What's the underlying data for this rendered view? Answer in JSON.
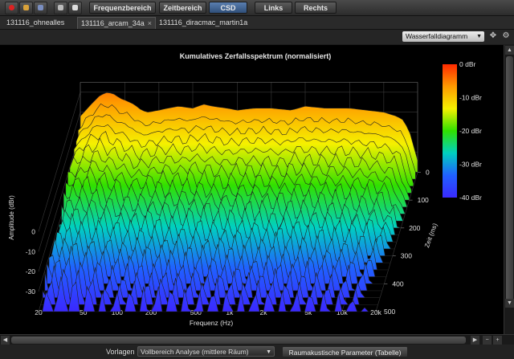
{
  "toolbar": {
    "icons": [
      "record-icon",
      "open-folder-icon",
      "save-icon",
      "export-icon",
      "print-icon"
    ],
    "tabs": [
      {
        "label": "Frequenzbereich",
        "active": false
      },
      {
        "label": "Zeitbereich",
        "active": false
      },
      {
        "label": "CSD",
        "active": true
      },
      {
        "label": "Links",
        "active": false
      },
      {
        "label": "Rechts",
        "active": false
      }
    ]
  },
  "file_tabs": [
    {
      "label": "131116_ohnealles",
      "active": false
    },
    {
      "label": "131116_arcam_34a",
      "active": true,
      "close": "×"
    },
    {
      "label": "131116_diracmac_martin1a",
      "active": false
    }
  ],
  "view_select": {
    "value": "Wasserfalldiagramm"
  },
  "chart_data": {
    "type": "waterfall",
    "title": "Kumulatives Zerfallsspektrum (normalisiert)",
    "xlabel": "Frequenz (Hz)",
    "ylabel": "Amplitude (dBr)",
    "zlabel": "Zeit (ms)",
    "x_scale": "log",
    "xlim": [
      20,
      20000
    ],
    "x_ticks": [
      "20",
      "50",
      "100",
      "200",
      "500",
      "1k",
      "2k",
      "5k",
      "10k",
      "20k"
    ],
    "x_tick_values": [
      20,
      50,
      100,
      200,
      500,
      1000,
      2000,
      5000,
      10000,
      20000
    ],
    "y_ticks": [
      "0",
      "-10",
      "-20",
      "-30"
    ],
    "y_tick_values": [
      0,
      -10,
      -20,
      -30
    ],
    "ylim": [
      -40,
      5
    ],
    "z_ticks": [
      "0",
      "100",
      "200",
      "300",
      "400",
      "500"
    ],
    "z_tick_values": [
      0,
      100,
      200,
      300,
      400,
      500
    ],
    "zlim": [
      0,
      500
    ],
    "colorbar": {
      "labels": [
        "0 dBr",
        "-10 dBr",
        "-20 dBr",
        "-30 dBr",
        "-40 dBr"
      ],
      "values": [
        0,
        -10,
        -20,
        -30,
        -40
      ],
      "colors": [
        "#ff2a00",
        "#ff9a00",
        "#f5f000",
        "#30e000",
        "#00d0c0",
        "#2060ff",
        "#3a2aff"
      ]
    },
    "slice_times_ms": [
      0,
      25,
      50,
      75,
      100,
      125,
      150,
      175,
      200,
      225,
      250,
      275,
      300,
      325,
      350,
      375,
      400,
      425,
      450,
      475,
      500
    ],
    "base_response": {
      "freq_hz": [
        20,
        25,
        30,
        35,
        40,
        45,
        50,
        60,
        70,
        80,
        100,
        120,
        150,
        200,
        250,
        300,
        400,
        500,
        700,
        1000,
        1500,
        2000,
        3000,
        5000,
        7000,
        10000,
        13000,
        15000,
        17000,
        20000
      ],
      "dbr": [
        -12,
        -6,
        -1.5,
        0,
        -1,
        -3,
        -4,
        -6,
        -9,
        -10,
        -9,
        -8,
        -7,
        -8,
        -6,
        -7,
        -8,
        -9,
        -8,
        -8,
        -9,
        -7,
        -8,
        -8,
        -9,
        -10,
        -12,
        -14,
        -20,
        -34
      ]
    },
    "decay_db_per_100ms": 6,
    "grid": true
  },
  "bottom": {
    "presets_label": "Vorlagen",
    "presets_value": "Vollbereich Analyse (mittlere Räum)",
    "params_button": "Raumakustische Parameter (Tabelle)"
  }
}
